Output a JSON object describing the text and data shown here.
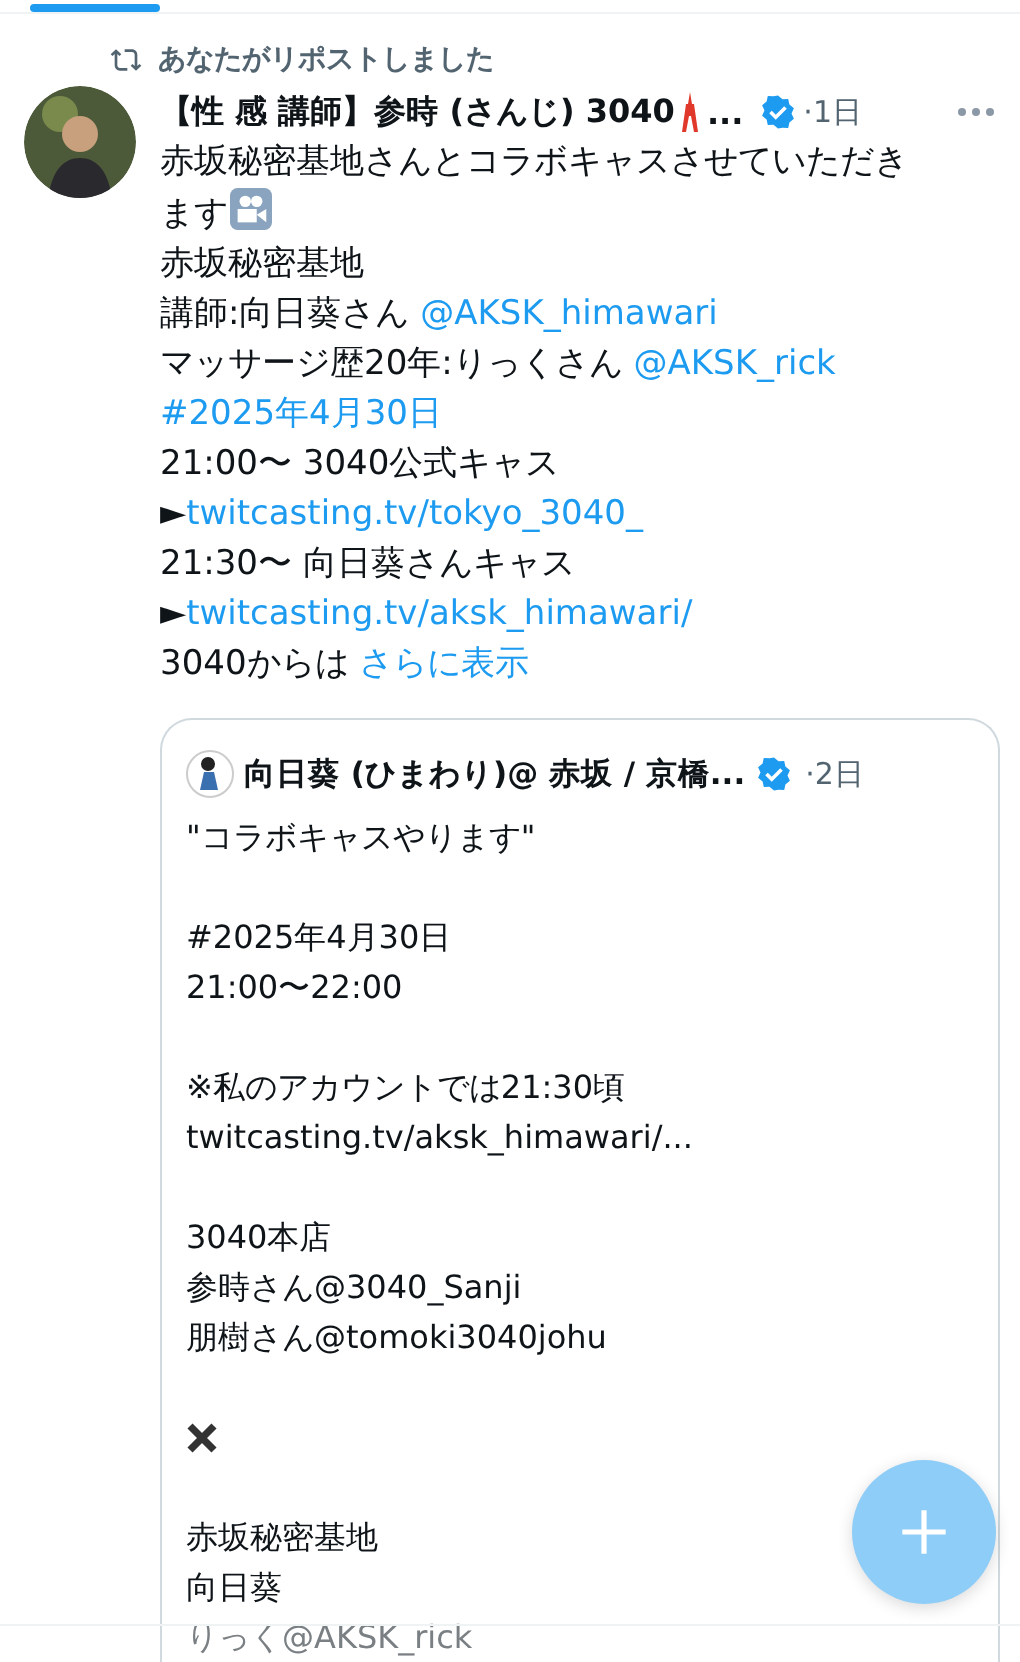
{
  "repost_label": "あなたがリポストしました",
  "post": {
    "author": "【性 感 講師】参時 (さんじ) 3040",
    "author_more": "...",
    "verified": true,
    "time": "·1日",
    "body": [
      [
        {
          "kind": "text",
          "text": "赤坂秘密基地さんとコラボキャスさせていただき"
        }
      ],
      [
        {
          "kind": "text",
          "text": "ます"
        },
        {
          "kind": "camera"
        }
      ],
      [
        {
          "kind": "text",
          "text": "赤坂秘密基地"
        }
      ],
      [
        {
          "kind": "text",
          "text": "講師:向日葵さん "
        },
        {
          "kind": "link",
          "text": "@AKSK_himawari"
        }
      ],
      [
        {
          "kind": "text",
          "text": "マッサージ歴20年:りっくさん "
        },
        {
          "kind": "link",
          "text": "@AKSK_rick"
        }
      ],
      [
        {
          "kind": "link",
          "text": "#2025年4月30日"
        }
      ],
      [
        {
          "kind": "text",
          "text": "21:00〜  3040公式キャス"
        }
      ],
      [
        {
          "kind": "text",
          "text": "►"
        },
        {
          "kind": "link",
          "text": "twitcasting.tv/tokyo_3040_"
        }
      ],
      [
        {
          "kind": "text",
          "text": "21:30〜  向日葵さんキャス"
        }
      ],
      [
        {
          "kind": "text",
          "text": "►"
        },
        {
          "kind": "link",
          "text": "twitcasting.tv/aksk_himawari/"
        }
      ],
      [
        {
          "kind": "text",
          "text": "3040からは "
        },
        {
          "kind": "link",
          "text": "さらに表示"
        }
      ]
    ]
  },
  "quote": {
    "author": "向日葵 (ひまわり)@ 赤坂 / 京橋...",
    "verified": true,
    "time": "·2日",
    "lines": [
      {
        "kind": "text",
        "text": "\"コラボキャスやります\""
      },
      {
        "kind": "blank"
      },
      {
        "kind": "text",
        "text": "#2025年4月30日"
      },
      {
        "kind": "text",
        "text": "21:00〜22:00"
      },
      {
        "kind": "blank"
      },
      {
        "kind": "text",
        "text": "※私のアカウントでは21:30頃"
      },
      {
        "kind": "text",
        "text": "twitcasting.tv/aksk_himawari/..."
      },
      {
        "kind": "blank"
      },
      {
        "kind": "text",
        "text": "3040本店"
      },
      {
        "kind": "text",
        "text": "参時さん@3040_Sanji"
      },
      {
        "kind": "text",
        "text": "朋樹さん@tomoki3040johu"
      },
      {
        "kind": "blank"
      },
      {
        "kind": "cross"
      },
      {
        "kind": "blank"
      },
      {
        "kind": "text",
        "text": "赤坂秘密基地"
      },
      {
        "kind": "text",
        "text": "向日葵"
      },
      {
        "kind": "faded",
        "text": "りっく@AKSK_rick"
      }
    ]
  }
}
